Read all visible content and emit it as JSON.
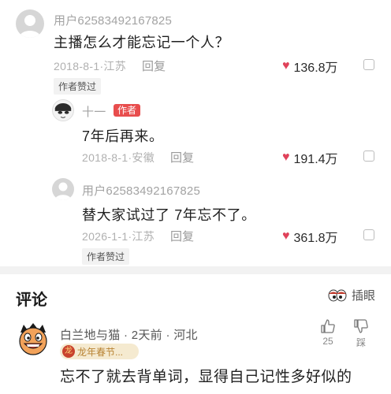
{
  "comment1": {
    "username": "用户6258349216782​5",
    "text": "主播怎么才能忘记一个人？",
    "date_location": "2018-8-1·江苏",
    "reply_label": "回复",
    "likes": "136.8万",
    "liked_tag": "作者赞过"
  },
  "reply1": {
    "username": "十一",
    "badge": "作者",
    "text": "7年后再来。",
    "date_location": "2018-8-1·安徽",
    "reply_label": "回复",
    "likes": "191.4万"
  },
  "reply2": {
    "username": "用户62583492167825",
    "text": "替大家试过了 7年忘不了。",
    "date_location": "2026-1-1·江苏",
    "reply_label": "回复",
    "likes": "361.8万",
    "liked_tag": "作者赞过"
  },
  "comments_section": {
    "title": "评论",
    "insert_label": "插眼"
  },
  "comment_bottom": {
    "username": "白兰地与猫 · 2天前 · 河北",
    "badge": "龙年春节...",
    "text": "忘不了就去背单词，显得自己记性多好似的",
    "like_count": "25",
    "dislike_label": "踩"
  },
  "colors": {
    "heart": "#e0425a",
    "author_badge": "#e84d4d",
    "badge_bg": "#f5ead0"
  }
}
